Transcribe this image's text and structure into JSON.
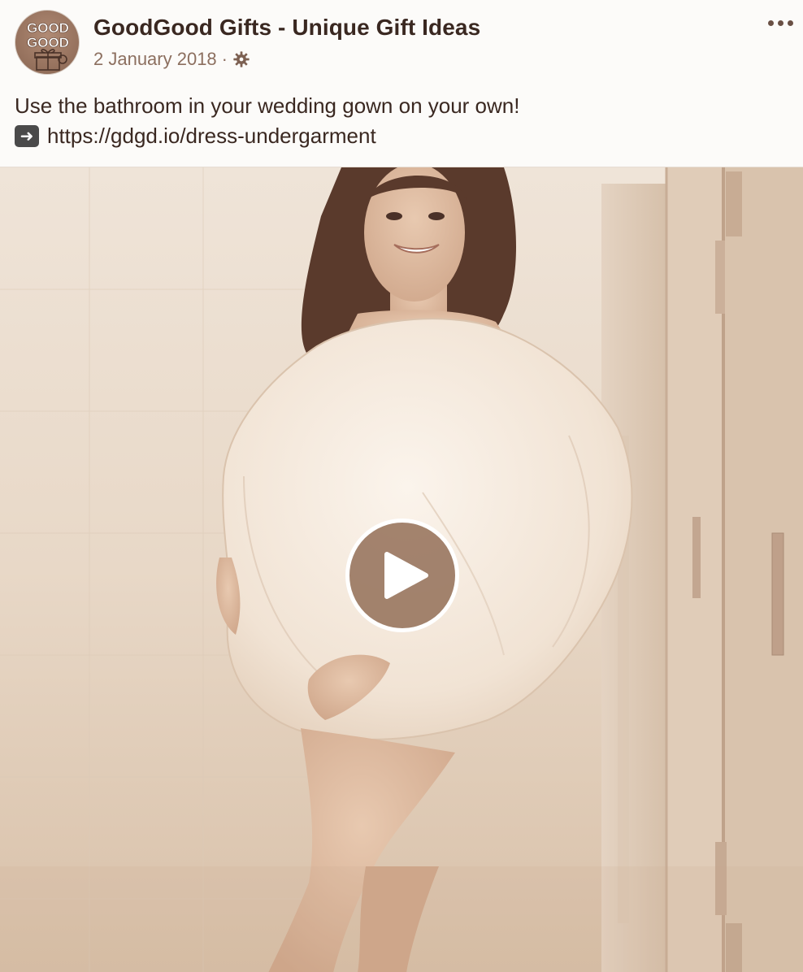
{
  "post": {
    "page_name": "GoodGood Gifts - Unique Gift Ideas",
    "date": "2 January 2018",
    "separator": "·",
    "audience_icon": "gear-icon",
    "more_icon": "more-options-icon",
    "avatar": {
      "logo_text_top": "GOOD",
      "logo_text_bottom": "GOOD",
      "icon": "gift-box-icon"
    },
    "caption": {
      "line1": "Use the bathroom in your wedding gown on your own!",
      "arrow_icon": "right-arrow-emoji",
      "link": "https://gdgd.io/dress-undergarment"
    },
    "media": {
      "type": "video",
      "play_icon": "play-icon"
    }
  },
  "colors": {
    "text_primary": "#3a2821",
    "text_meta": "#8c6f5f",
    "play_button": "#96735c",
    "background": "#fcfbf9"
  }
}
